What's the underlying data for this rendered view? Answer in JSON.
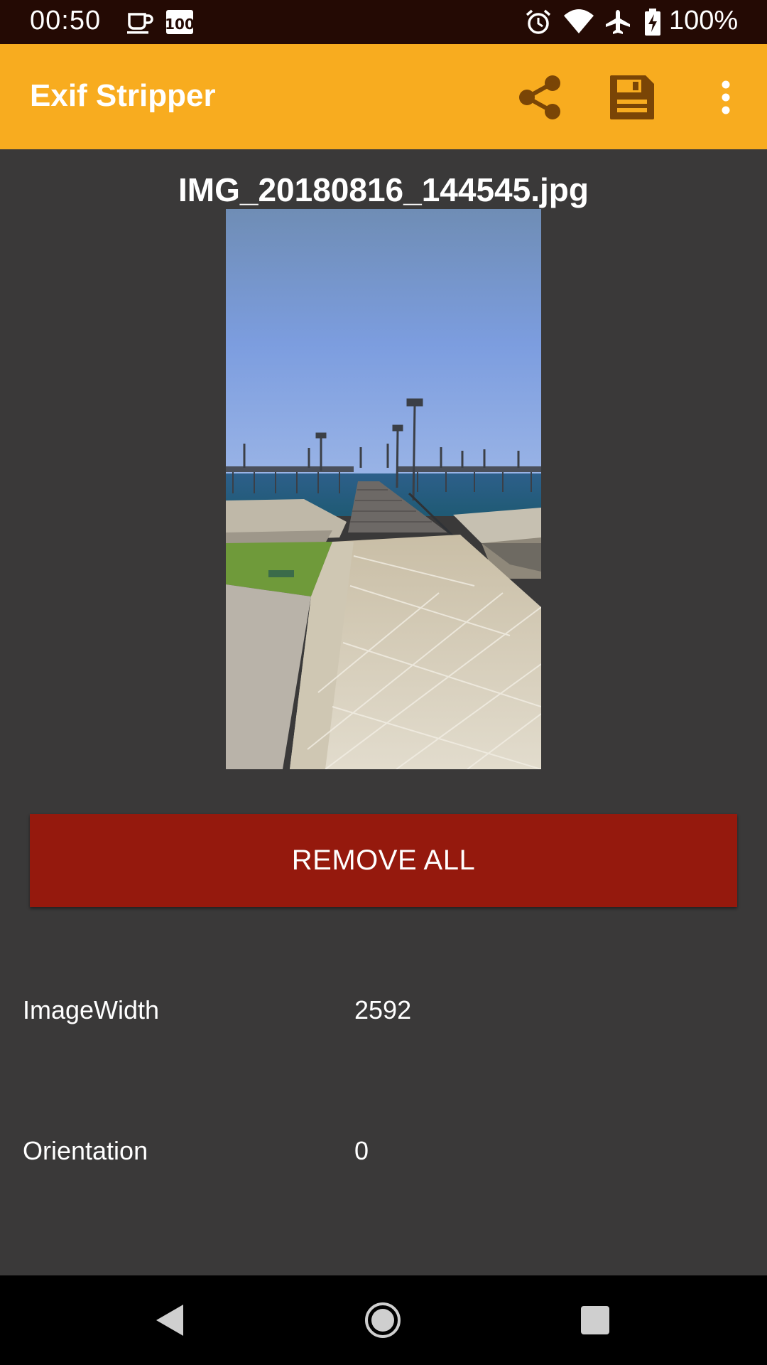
{
  "status_bar": {
    "time": "00:50",
    "battery_text": "100%",
    "icons": [
      "coffee-cup-icon",
      "battery-100-notification-icon",
      "alarm-icon",
      "wifi-icon",
      "airplane-icon",
      "battery-charging-icon"
    ]
  },
  "app_bar": {
    "title": "Exif Stripper",
    "background": "#f8ac1f",
    "actions": [
      "share-icon",
      "save-icon",
      "overflow-menu-icon"
    ]
  },
  "main": {
    "file_name": "IMG_20180816_144545.jpg",
    "remove_all_label": "REMOVE ALL",
    "remove_all_color": "#95190d",
    "exif": [
      {
        "key": "ImageWidth",
        "value": "2592"
      },
      {
        "key": "Orientation",
        "value": "0"
      }
    ]
  },
  "nav_bar": {
    "buttons": [
      "back-icon",
      "home-icon",
      "recents-icon"
    ]
  }
}
